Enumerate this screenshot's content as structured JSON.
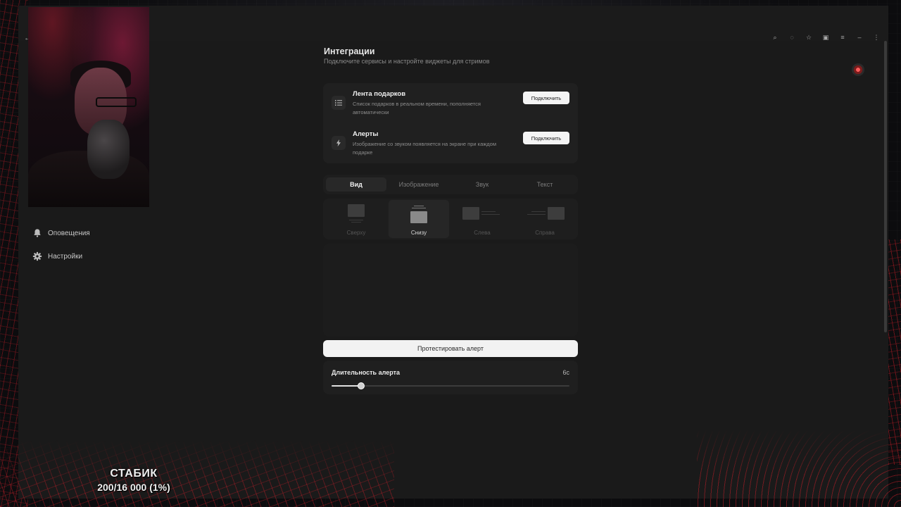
{
  "page": {
    "title": "Интеграции",
    "subtitle": "Подключите сервисы и настройте виджеты для стримов"
  },
  "sidebar": {
    "items": [
      {
        "label": "Оповещения",
        "icon": "bell-icon"
      },
      {
        "label": "Настройки",
        "icon": "gear-icon"
      }
    ]
  },
  "integrations": [
    {
      "name": "Лента подарков",
      "description": "Список подарков в реальном времени, пополняется автоматически",
      "button": "Подключить",
      "icon": "list-icon"
    },
    {
      "name": "Алерты",
      "description": "Изображение со звуком появляется на экране при каждом подарке",
      "button": "Подключить",
      "icon": "bolt-icon"
    }
  ],
  "tabs": [
    "Вид",
    "Изображение",
    "Звук",
    "Текст"
  ],
  "active_tab": "Вид",
  "positions": [
    "Сверху",
    "Снизу",
    "Слева",
    "Справа"
  ],
  "active_position": "Снизу",
  "test_button": "Протестировать алерт",
  "duration": {
    "label": "Длительность алерта",
    "value": "6с",
    "slider_fraction": 0.125
  },
  "overlay": {
    "sub_name": "СТАБИК",
    "sub_count": "200/16 000 (1%)"
  },
  "colors": {
    "background": "#1a1a1a",
    "card": "#202020",
    "button": "#f4f4f4",
    "accent_red": "#c81e28"
  }
}
